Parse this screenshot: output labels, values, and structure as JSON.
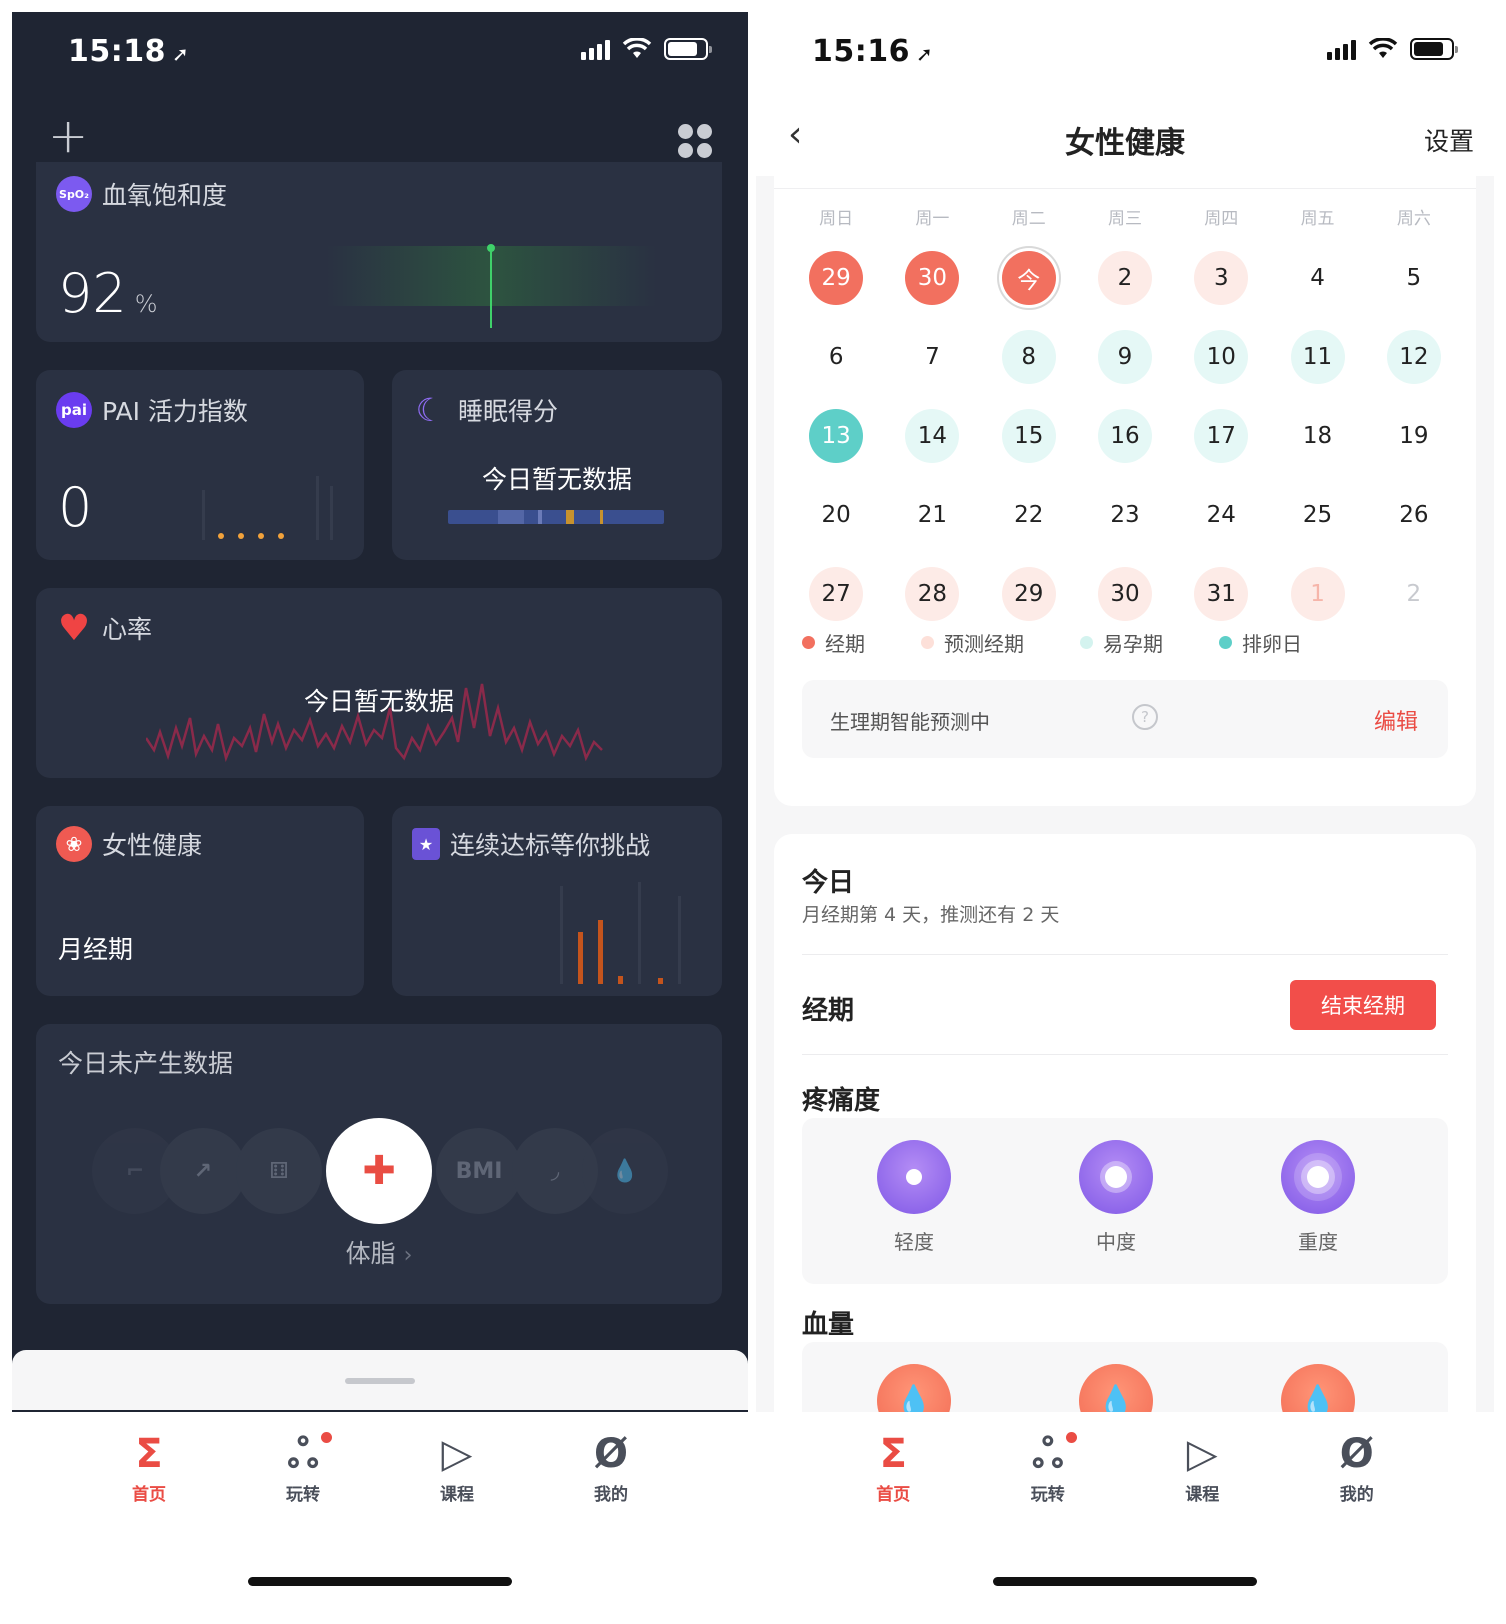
{
  "left": {
    "status": {
      "time": "15:18",
      "arrow": "➚"
    },
    "topbar": {
      "plus": "+"
    },
    "spo2": {
      "title": "血氧饱和度",
      "icon_text": "SpO₂",
      "value": "92",
      "unit": "%"
    },
    "pai": {
      "title": "PAI 活力指数",
      "icon_text": "pai",
      "value": "0"
    },
    "sleep": {
      "title": "睡眠得分",
      "nodata": "今日暂无数据"
    },
    "heart": {
      "title": "心率",
      "nodata": "今日暂无数据"
    },
    "female": {
      "title": "女性健康",
      "status": "月经期"
    },
    "streak": {
      "title": "连续达标等你挑战"
    },
    "body": {
      "title": "今日未产生数据",
      "bmi": "BMI",
      "label": "体脂",
      "chevron": "›"
    },
    "tabs": [
      {
        "label": "首页",
        "icon": "Σ"
      },
      {
        "label": "玩转",
        "icon": "ஃ"
      },
      {
        "label": "课程",
        "icon": "▷"
      },
      {
        "label": "我的",
        "icon": "Ø"
      }
    ]
  },
  "right": {
    "status": {
      "time": "15:16",
      "arrow": "➚"
    },
    "nav": {
      "back": "‹",
      "title": "女性健康",
      "settings": "设置"
    },
    "weekdays": [
      "周日",
      "周一",
      "周二",
      "周三",
      "周四",
      "周五",
      "周六"
    ],
    "days": [
      {
        "label": "29",
        "type": "period"
      },
      {
        "label": "30",
        "type": "period"
      },
      {
        "label": "今",
        "type": "today"
      },
      {
        "label": "2",
        "type": "pred"
      },
      {
        "label": "3",
        "type": "pred"
      },
      {
        "label": "4",
        "type": ""
      },
      {
        "label": "5",
        "type": ""
      },
      {
        "label": "6",
        "type": ""
      },
      {
        "label": "7",
        "type": ""
      },
      {
        "label": "8",
        "type": "fertile"
      },
      {
        "label": "9",
        "type": "fertile"
      },
      {
        "label": "10",
        "type": "fertile"
      },
      {
        "label": "11",
        "type": "fertile"
      },
      {
        "label": "12",
        "type": "fertile"
      },
      {
        "label": "13",
        "type": "ovul"
      },
      {
        "label": "14",
        "type": "fertile"
      },
      {
        "label": "15",
        "type": "fertile"
      },
      {
        "label": "16",
        "type": "fertile"
      },
      {
        "label": "17",
        "type": "fertile"
      },
      {
        "label": "18",
        "type": ""
      },
      {
        "label": "19",
        "type": ""
      },
      {
        "label": "20",
        "type": ""
      },
      {
        "label": "21",
        "type": ""
      },
      {
        "label": "22",
        "type": ""
      },
      {
        "label": "23",
        "type": ""
      },
      {
        "label": "24",
        "type": ""
      },
      {
        "label": "25",
        "type": ""
      },
      {
        "label": "26",
        "type": ""
      },
      {
        "label": "27",
        "type": "pred"
      },
      {
        "label": "28",
        "type": "pred"
      },
      {
        "label": "29",
        "type": "pred"
      },
      {
        "label": "30",
        "type": "pred"
      },
      {
        "label": "31",
        "type": "pred"
      },
      {
        "label": "1",
        "type": "dimpred"
      },
      {
        "label": "2",
        "type": "dim"
      }
    ],
    "legend": [
      {
        "label": "经期",
        "color": "#f2705f"
      },
      {
        "label": "预测经期",
        "color": "#fde0d9"
      },
      {
        "label": "易孕期",
        "color": "#d4f3ef"
      },
      {
        "label": "排卵日",
        "color": "#5ecfc8"
      }
    ],
    "predict": {
      "text": "生理期智能预测中",
      "help": "?",
      "edit": "编辑"
    },
    "today": {
      "title": "今日",
      "subtitle": "月经期第 4 天，推测还有 2 天"
    },
    "period": {
      "title": "经期",
      "button": "结束经期"
    },
    "pain": {
      "title": "疼痛度",
      "options": [
        "轻度",
        "中度",
        "重度"
      ]
    },
    "blood": {
      "title": "血量"
    },
    "tabs": [
      {
        "label": "首页",
        "icon": "Σ"
      },
      {
        "label": "玩转",
        "icon": "ஃ"
      },
      {
        "label": "课程",
        "icon": "▷"
      },
      {
        "label": "我的",
        "icon": "Ø"
      }
    ]
  },
  "colors": {
    "accent": "#ea4c44",
    "period": "#f2705f",
    "ovulation": "#5ecfc8",
    "dark_bg": "#1f2533",
    "card_bg": "#2a3142"
  }
}
